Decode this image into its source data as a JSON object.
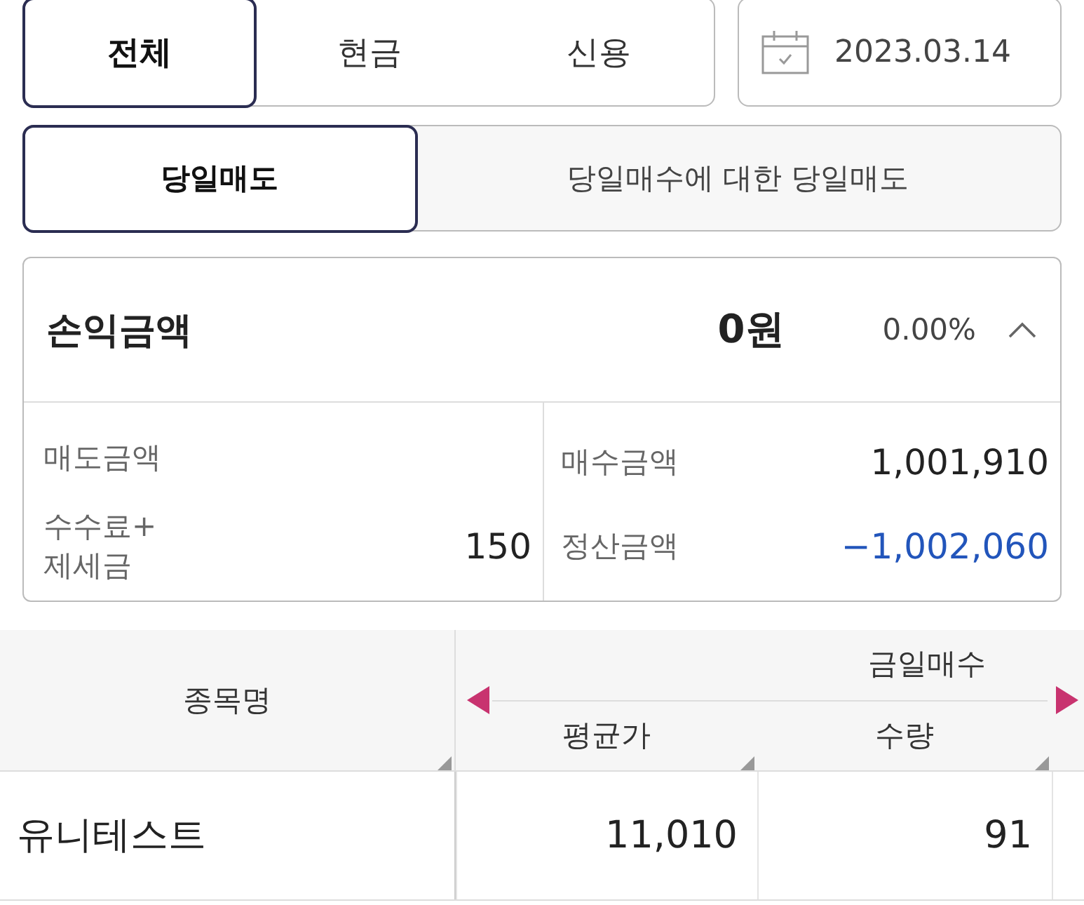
{
  "account_tabs": [
    {
      "label": "전체",
      "selected": true
    },
    {
      "label": "현금",
      "selected": false
    },
    {
      "label": "신용",
      "selected": false
    }
  ],
  "date": "2023.03.14",
  "trade_tabs": [
    {
      "label": "당일매도",
      "selected": true
    },
    {
      "label": "당일매수에 대한 당일매도",
      "selected": false
    }
  ],
  "summary": {
    "title": "손익금액",
    "amount": "0원",
    "rate": "0.00%",
    "expanded": true,
    "items": [
      {
        "label": "매도금액",
        "value": "",
        "kind": "normal"
      },
      {
        "label": "매수금액",
        "value": "1,001,910",
        "kind": "normal"
      },
      {
        "label": "수수료+\n제세금",
        "value": "150",
        "kind": "normal"
      },
      {
        "label": "정산금액",
        "value": "−1,002,060",
        "kind": "negative"
      }
    ]
  },
  "table": {
    "name_column": "종목명",
    "group": "금일매수",
    "columns": [
      "평균가",
      "수량"
    ],
    "rows": [
      {
        "name": "유니테스트",
        "cells": [
          "11,010",
          "91"
        ]
      }
    ]
  }
}
